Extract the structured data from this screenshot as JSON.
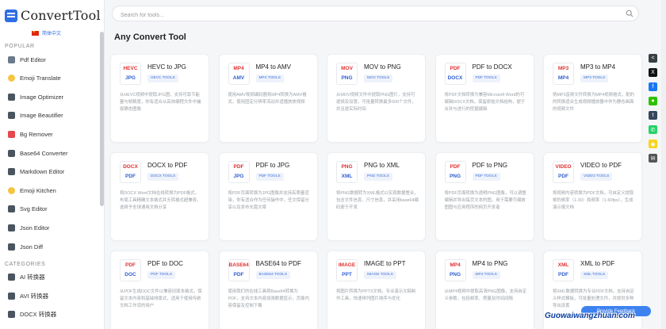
{
  "brand": {
    "logo_text": "ConvertTool",
    "language": "简体中文"
  },
  "sidebar": {
    "sections": [
      {
        "heading": "POPULAR",
        "items": [
          {
            "label": "Pdf Editor",
            "icon": "pdf-editor-icon",
            "color": "#6c7a8a"
          },
          {
            "label": "Emoji Translate",
            "icon": "emoji-icon",
            "color": "#f5c542"
          },
          {
            "label": "Image Optimizer",
            "icon": "image-icon",
            "color": "#4a5560"
          },
          {
            "label": "Image Beautifier",
            "icon": "image-icon",
            "color": "#4a5560"
          },
          {
            "label": "Bg Remover",
            "icon": "magic-wand-icon",
            "color": "#e5484d"
          },
          {
            "label": "Base64 Converter",
            "icon": "code-icon",
            "color": "#4a5560"
          },
          {
            "label": "Markdown Editor",
            "icon": "markdown-icon",
            "color": "#4a5560"
          },
          {
            "label": "Emoji Kitchen",
            "icon": "emoji-icon",
            "color": "#f5c542"
          },
          {
            "label": "Svg Editor",
            "icon": "svg-icon",
            "color": "#4a5560"
          },
          {
            "label": "Json Editor",
            "icon": "json-icon",
            "color": "#4a5560"
          },
          {
            "label": "Json Diff",
            "icon": "diff-icon",
            "color": "#4a5560"
          }
        ]
      },
      {
        "heading": "CATEGORIES",
        "items": [
          {
            "label": "AI 转换器",
            "icon": "ai-icon",
            "color": "#4a5560"
          },
          {
            "label": "AVI 转换器",
            "icon": "video-icon",
            "color": "#4a5560"
          },
          {
            "label": "DOCX 转换器",
            "icon": "document-icon",
            "color": "#4a5560"
          }
        ]
      }
    ]
  },
  "search": {
    "placeholder": "Search for tools..."
  },
  "page_title": "Any Convert Tool",
  "cards": [
    {
      "from": "HEVC",
      "to": "JPG",
      "title": "HEVC to JPG",
      "tag": "HEVC TOOLS",
      "desc": "从HEVC视频中提取JPG图，支持可靠节能量与帧精度，你有适合从高效编程文件中捕捉静态图像"
    },
    {
      "from": "MP4",
      "to": "AMV",
      "title": "MP4 to AMV",
      "tag": "MP4 TOOLS",
      "desc": "使用AMV视频编码器将MP4转换为AMV格式，使用固定分辨率流动并适播放放视频"
    },
    {
      "from": "MOV",
      "to": "PNG",
      "title": "MOV to PNG",
      "tag": "MOV TOOLS",
      "desc": "从MOV视频文件中提取PNG图片，支持可逐帧及设置。可批量转换最多500个文件，并且逐实际时间"
    },
    {
      "from": "PDF",
      "to": "DOCX",
      "title": "PDF to DOCX",
      "tag": "PDF TOOLS",
      "desc": "将PDF文档转换为兼容Microsoft Word的可编辑DOCX文档，保留原始文档结构，便于合并与进行的挖掘编辑"
    },
    {
      "from": "MP3",
      "to": "MP4",
      "title": "MP3 to MP4",
      "tag": "MP3 TOOLS",
      "desc": "将MP3音频文件转换为MP4视频格式，配的的转换适合生成视频播放器中作为静态画面的视频文件"
    },
    {
      "from": "DOCX",
      "to": "PDF",
      "title": "DOCX to PDF",
      "tag": "DOCX TOOLS",
      "desc": "将DOCX Word文档在线转换为PDF格式，布局工具精确文本格式并无转格式超兼容，选择予全球通用文档分享"
    },
    {
      "from": "PDF",
      "to": "JPG",
      "title": "PDF to JPG",
      "tag": "PDF TOOLS",
      "desc": "将PDF页面转换为JPG图像并支持高质量渲染，你有适合作为任何操作中，任文保留分享以及发布长篇文章"
    },
    {
      "from": "PNG",
      "to": "XML",
      "title": "PNG to XML",
      "tag": "PNG TOOLS",
      "desc": "将PNG数据转为XML格式以实现数据整合，包含文件信息、尺寸信息，并采用base64编码便于开发"
    },
    {
      "from": "PDF",
      "to": "PNG",
      "title": "PDF to PNG",
      "tag": "PDF TOOLS",
      "desc": "将PDF页面转换为透明PNG图像，可以调整编辑并导出每页文本的图，用于需要可编放图图与应用程序的网页开发者"
    },
    {
      "from": "VIDEO",
      "to": "PDF",
      "title": "VIDEO to PDF",
      "tag": "VIDEO TOOLS",
      "desc": "将视频内容转换为PDF文档，可自定义提取帧的频率（1-30）和频率（1-60fps），生成演示报文档"
    },
    {
      "from": "PDF",
      "to": "DOC",
      "title": "PDF to DOC",
      "tag": "PDF TOOLS",
      "desc": "从PDF生成DOC文件以兼容旧版本格式，保留文本内容和基础排版式，适用于使用传统文档工作流的用户"
    },
    {
      "from": "BASE64",
      "to": "PDF",
      "title": "BASE64 to PDF",
      "tag": "BASE64 TOOLS",
      "desc": "使用我们的在线工具将Base64转换为PDF，支持文本内容加强数据显示，页面内容保留及控制下载"
    },
    {
      "from": "IMAGE",
      "to": "PPT",
      "title": "IMAGE to PPT",
      "tag": "IMAGE TOOLS",
      "desc": "将图片转换为PPTX文档，专业演示文稿制作工具，快速排列图片排序与优化"
    },
    {
      "from": "MP4",
      "to": "PNG",
      "title": "MP4 to PNG",
      "tag": "MP4 TOOLS",
      "desc": "从MP4视频中提取高清PNG图像，支持自定义参数，包括帧率、质量及时间间隔"
    },
    {
      "from": "XML",
      "to": "PDF",
      "title": "XML to PDF",
      "tag": "XML TOOLS",
      "desc": "将XML数据转换为专业PDF文档，支持自定义样式模板，可批量处理文件，并提供多种导出设置"
    }
  ],
  "share": [
    {
      "icon": "share-icon",
      "color": "#3a3f45",
      "glyph": "<"
    },
    {
      "icon": "x-icon",
      "color": "#111111",
      "glyph": "X"
    },
    {
      "icon": "facebook-icon",
      "color": "#1877f2",
      "glyph": "f"
    },
    {
      "icon": "wechat-icon",
      "color": "#2dc100",
      "glyph": "●"
    },
    {
      "icon": "tumblr-icon",
      "color": "#36465d",
      "glyph": "t"
    },
    {
      "icon": "whatsapp-icon",
      "color": "#25d366",
      "glyph": "✆"
    },
    {
      "icon": "snapchat-icon",
      "color": "#f7d51d",
      "glyph": "◉"
    },
    {
      "icon": "email-icon",
      "color": "#555555",
      "glyph": "✉"
    }
  ],
  "feedback_label": "Provide Feedback",
  "watermark": "Guowaiwangzhuan.com"
}
